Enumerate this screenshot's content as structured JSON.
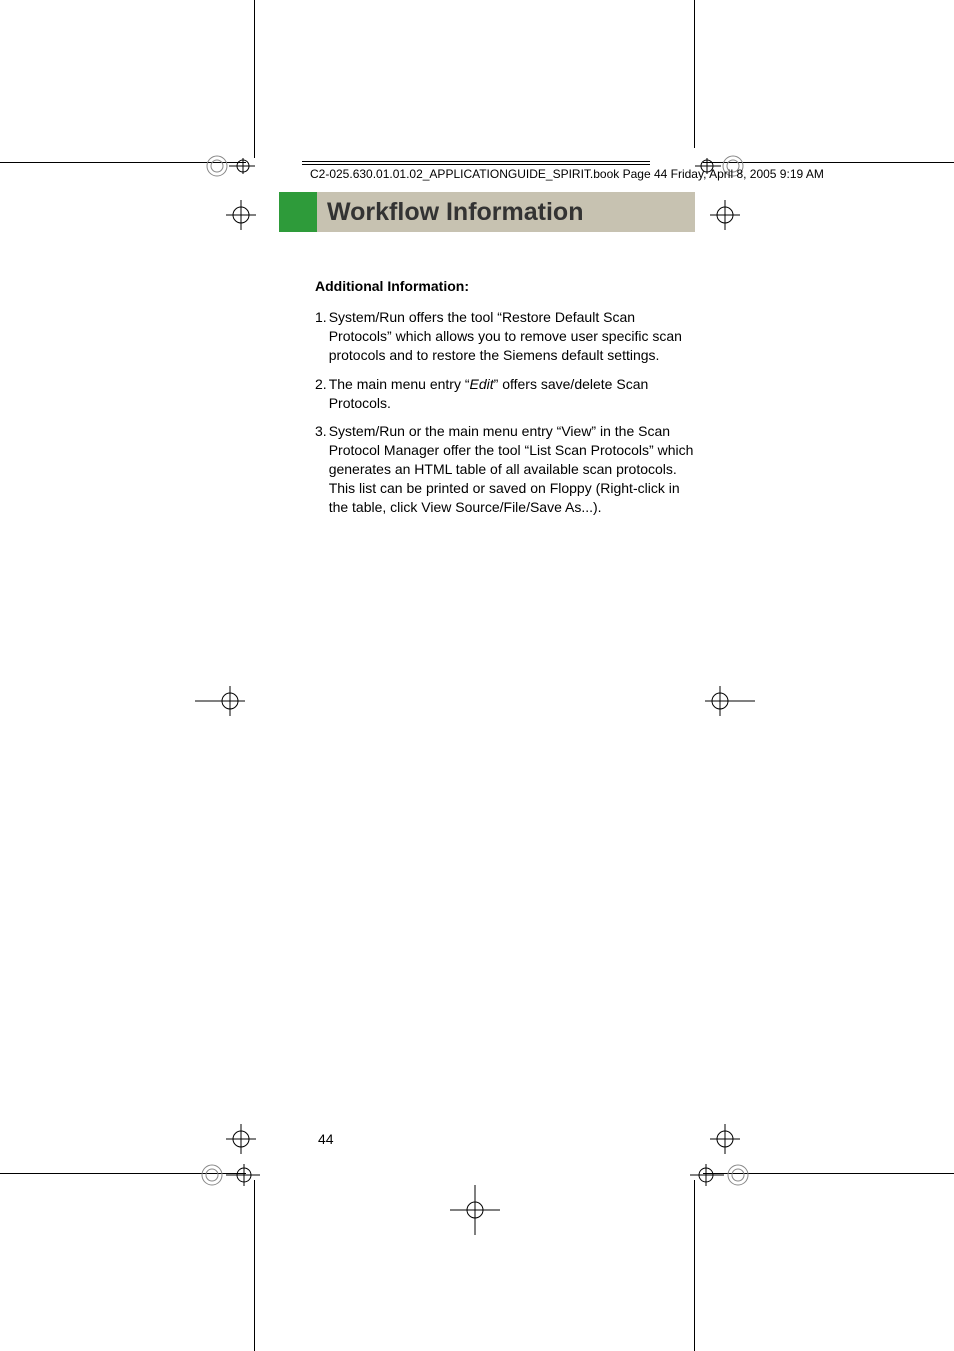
{
  "header_line": "C2-025.630.01.01.02_APPLICATIONGUIDE_SPIRIT.book  Page 44  Friday, April 8, 2005  9:19 AM",
  "section_title": "Workflow Information",
  "subheading": "Additional Information:",
  "items": [
    {
      "num": "1.",
      "text": "System/Run offers the tool “Restore Default Scan Protocols” which allows you to remove user specific scan protocols and to restore the Siemens default settings."
    },
    {
      "num": "2.",
      "text_before": "The main menu entry “",
      "italic": "Edit",
      "text_after": "” offers save/delete Scan Protocols."
    },
    {
      "num": "3.",
      "text": "System/Run or the main menu entry “View” in the Scan Protocol Manager offer the tool “List Scan Protocols” which generates an HTML table of all available scan protocols. This list can be printed or saved on Floppy (Right-click in the table, click View Source/File/Save As...)."
    }
  ],
  "page_number": "44"
}
